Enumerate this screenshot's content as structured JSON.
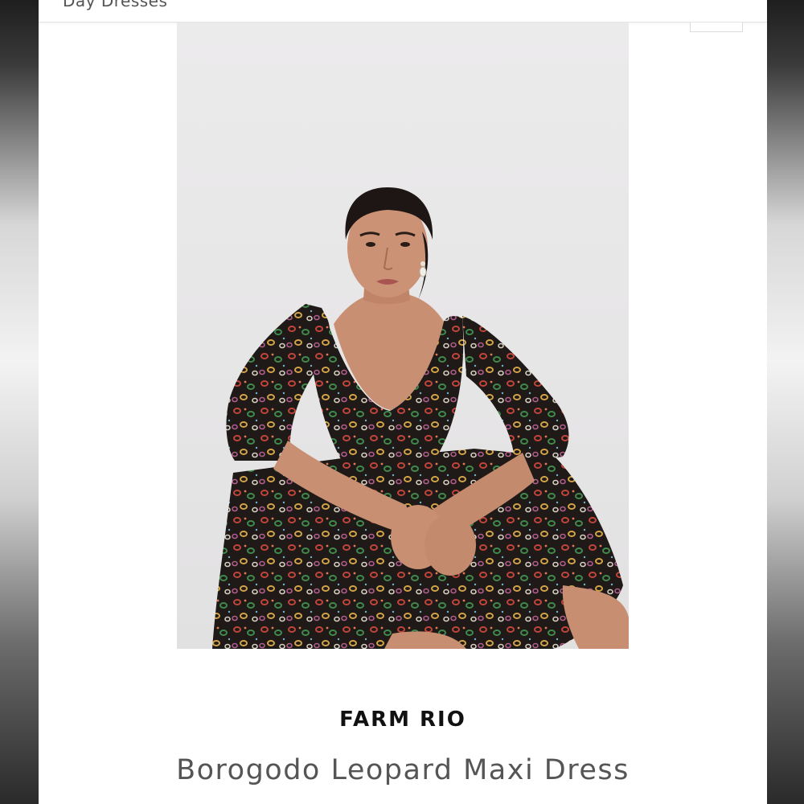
{
  "header": {
    "breadcrumb": "Day Dresses"
  },
  "product": {
    "image_alt": "Model seated wearing a long-sleeve dark leopard print maxi dress",
    "brand": "FARM RIO",
    "name": "Borogodo Leopard Maxi Dress"
  },
  "colors": {
    "background": "#ffffff",
    "photo_backdrop": "#e8e7e8",
    "dress_base": "#1f1a17",
    "brand_text": "#111111",
    "name_text": "#555555"
  }
}
